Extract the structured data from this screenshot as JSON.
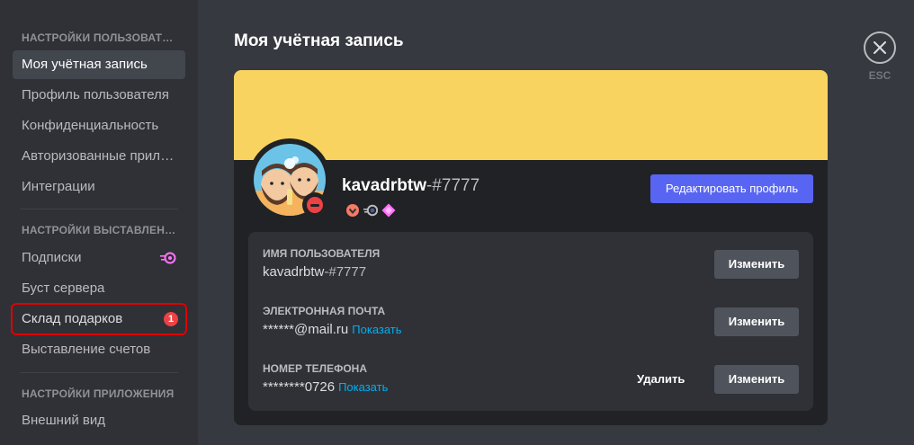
{
  "sidebar": {
    "sections": [
      {
        "header": "НАСТРОЙКИ ПОЛЬЗОВАТЕЛЯ"
      },
      {
        "header": "НАСТРОЙКИ ВЫСТАВЛЕНИЯ СЧЕТОВ"
      },
      {
        "header": "НАСТРОЙКИ ПРИЛОЖЕНИЯ"
      }
    ],
    "items": [
      {
        "label": "Моя учётная запись"
      },
      {
        "label": "Профиль пользователя"
      },
      {
        "label": "Конфиденциальность"
      },
      {
        "label": "Авторизованные приложения"
      },
      {
        "label": "Интеграции"
      },
      {
        "label": "Подписки"
      },
      {
        "label": "Буст сервера"
      },
      {
        "label": "Склад подарков",
        "badge": "1"
      },
      {
        "label": "Выставление счетов"
      },
      {
        "label": "Внешний вид"
      }
    ]
  },
  "main": {
    "title": "Моя учётная запись",
    "close_label": "ESC",
    "profile": {
      "username": "kavadrbtw",
      "discriminator": "-#7777",
      "edit_button": "Редактировать профиль",
      "banner_color": "#f8d35f",
      "status": "dnd",
      "badges": [
        "hypesquad-icon",
        "nitro-icon",
        "boost-icon"
      ]
    },
    "fields": [
      {
        "label": "ИМЯ ПОЛЬЗОВАТЕЛЯ",
        "value": "kavadrbtw",
        "value_suffix": "-#7777",
        "button": "Изменить"
      },
      {
        "label": "ЭЛЕКТРОННАЯ ПОЧТА",
        "value": "******@mail.ru",
        "link": "Показать",
        "button": "Изменить"
      },
      {
        "label": "НОМЕР ТЕЛЕФОНА",
        "value": "********0726",
        "link": "Показать",
        "button": "Изменить",
        "remove_button": "Удалить"
      }
    ]
  },
  "colors": {
    "accent": "#5865f2",
    "highlight_box": "#e00000",
    "badge": "#ed4245",
    "link": "#00aff4"
  }
}
